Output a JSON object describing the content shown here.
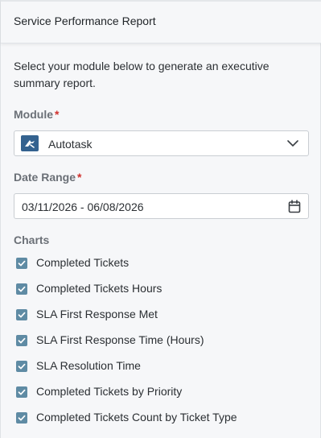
{
  "header": {
    "title": "Service Performance Report"
  },
  "intro": "Select your module below to generate an executive summary report.",
  "module": {
    "label": "Module",
    "required_mark": "*",
    "selected": "Autotask",
    "logo_icon": "autotask-logo-icon"
  },
  "date_range": {
    "label": "Date Range",
    "required_mark": "*",
    "value": "03/11/2026 - 06/08/2026"
  },
  "charts": {
    "label": "Charts",
    "items": [
      {
        "label": "Completed Tickets",
        "checked": true
      },
      {
        "label": "Completed Tickets Hours",
        "checked": true
      },
      {
        "label": "SLA First Response Met",
        "checked": true
      },
      {
        "label": "SLA First Response Time (Hours)",
        "checked": true
      },
      {
        "label": "SLA Resolution Time",
        "checked": true
      },
      {
        "label": "Completed Tickets by Priority",
        "checked": true
      },
      {
        "label": "Completed Tickets Count by Ticket Type",
        "checked": true
      }
    ]
  },
  "colors": {
    "checkbox": "#5f8ba4",
    "required": "#d0312d",
    "logo_bg": "#34628f"
  }
}
